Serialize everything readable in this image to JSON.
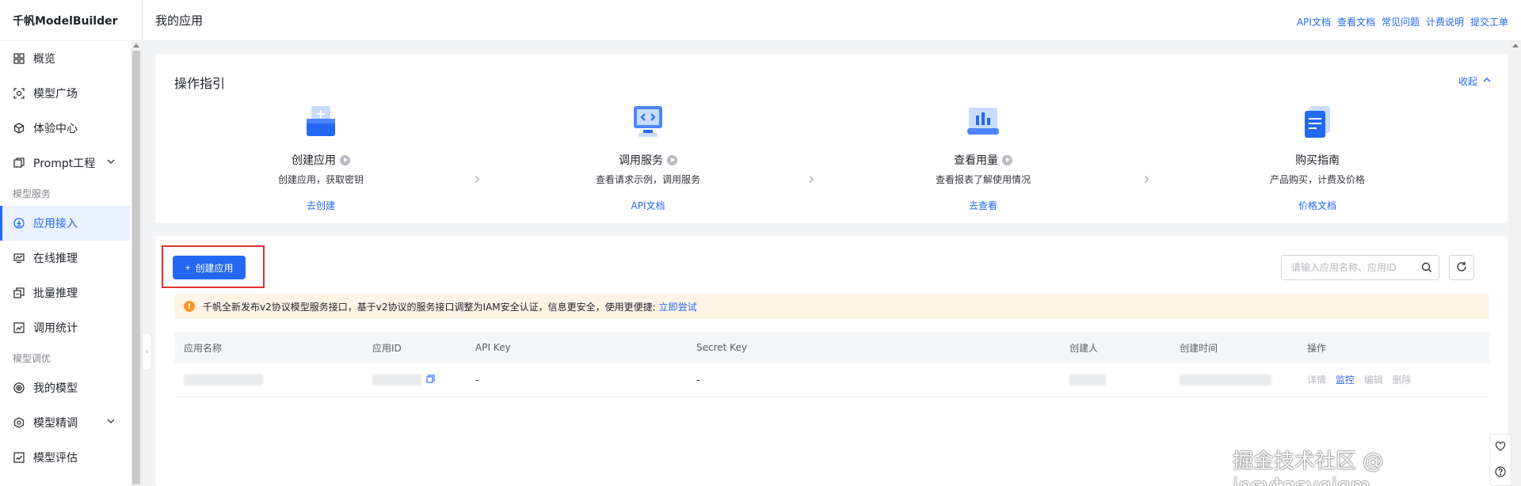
{
  "sidebar": {
    "brand": "千帆ModelBuilder",
    "items": [
      {
        "label": "概览"
      },
      {
        "label": "模型广场"
      },
      {
        "label": "体验中心"
      },
      {
        "label": "Prompt工程"
      },
      {
        "label": "应用接入"
      },
      {
        "label": "在线推理"
      },
      {
        "label": "批量推理"
      },
      {
        "label": "调用统计"
      },
      {
        "label": "我的模型"
      },
      {
        "label": "模型精调"
      },
      {
        "label": "模型评估"
      }
    ],
    "groups": [
      "模型服务",
      "模型调优"
    ]
  },
  "header": {
    "title": "我的应用",
    "links": [
      "API文档",
      "查看文档",
      "常见问题",
      "计费说明",
      "提交工单"
    ]
  },
  "guide": {
    "title": "操作指引",
    "collapse_label": "收起",
    "steps": [
      {
        "name": "创建应用",
        "desc": "创建应用，获取密钥",
        "link": "去创建"
      },
      {
        "name": "调用服务",
        "desc": "查看请求示例，调用服务",
        "link": "API文档"
      },
      {
        "name": "查看用量",
        "desc": "查看报表了解使用情况",
        "link": "去查看"
      },
      {
        "name": "购买指南",
        "desc": "产品购买，计费及价格",
        "link": "价格文档"
      }
    ]
  },
  "main": {
    "create_label": "创建应用",
    "search_placeholder": "请输入应用名称、应用ID",
    "notice_text": "千帆全新发布v2协议模型服务接口，基于v2协议的服务接口调整为IAM安全认证，信息更安全，使用更便捷:",
    "notice_link": "立即尝试",
    "table": {
      "headers": [
        "应用名称",
        "应用ID",
        "API Key",
        "Secret Key",
        "创建人",
        "创建时间",
        "操作"
      ],
      "row": {
        "api_key": "-",
        "secret_key": "-"
      },
      "ops": [
        "详情",
        "监控",
        "编辑",
        "删除"
      ]
    }
  },
  "watermark": "掘金技术社区 @ jnsytgsyqjgm",
  "colors": {
    "accent": "#2468f2",
    "highlight_border": "#e03131",
    "notice_bg": "#fff4e6",
    "warn": "#ff9326"
  }
}
